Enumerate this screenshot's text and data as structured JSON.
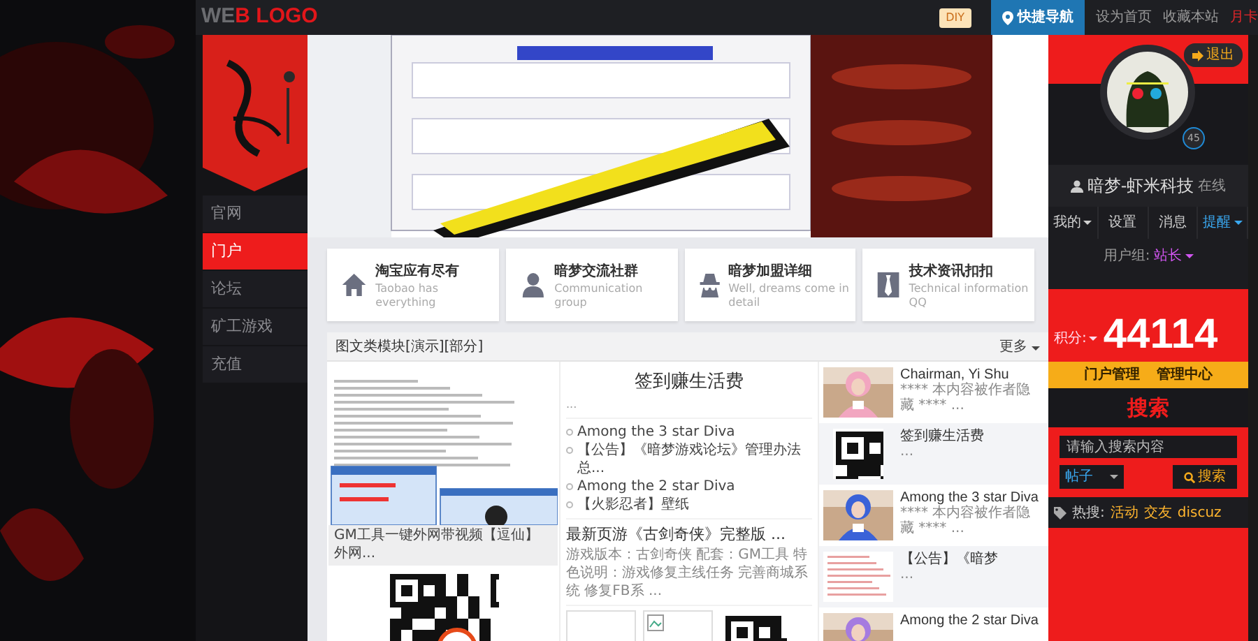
{
  "top_bar": {
    "logo": {
      "muted": "WE",
      "accent": "B LOGO"
    },
    "diy_badge": "DIY",
    "quick_nav": "快捷导航",
    "links": [
      {
        "label": "设为首页",
        "highlight": false
      },
      {
        "label": "收藏本站",
        "highlight": false
      },
      {
        "label": "月卡",
        "highlight": true
      }
    ]
  },
  "left_nav": [
    {
      "label": "官网",
      "selected": false
    },
    {
      "label": "门户",
      "selected": true
    },
    {
      "label": "论坛",
      "selected": false
    },
    {
      "label": "矿工游戏",
      "selected": false
    },
    {
      "label": "充值",
      "selected": false
    }
  ],
  "feature_cards": [
    {
      "title": "淘宝应有尽有",
      "subtitle": "Taobao has everything"
    },
    {
      "title": "暗梦交流社群",
      "subtitle": "Communication group"
    },
    {
      "title": "暗梦加盟详细",
      "subtitle": "Well, dreams come in detail"
    },
    {
      "title": "技术资讯扣扣",
      "subtitle": "Technical information QQ"
    }
  ],
  "panel": {
    "title": "图文类模块[演示][部分]",
    "more": "更多",
    "column_1": {
      "caption": "GM工具一键外网带视频【逗仙】外网..."
    },
    "column_2": {
      "title": "签到赚生活费",
      "excerpt": "...",
      "links": [
        "Among the 3 star Diva",
        "【公告】《暗梦游戏论坛》管理办法总...",
        "Among the 2 star Diva",
        "【火影忍者】壁纸"
      ],
      "article": {
        "title": "最新页游《古剑奇侠》完整版 ...",
        "summary": "游戏版本：古剑奇侠 配套：GM工具 特色说明：游戏修复主线任务 完善商城系统 修复FB系 ..."
      }
    },
    "column_3": [
      {
        "title": "Chairman, Yi Shu",
        "excerpt": "**** 本内容被作者隐藏 **** ..."
      },
      {
        "kind": "qr",
        "title": "签到赚生活费",
        "excerpt": "..."
      },
      {
        "title": "Among the 3 star Diva",
        "excerpt": "**** 本内容被作者隐藏 **** ..."
      },
      {
        "kind": "document",
        "title": "【公告】《暗梦",
        "excerpt": "..."
      },
      {
        "title": "Among the 2 star Diva"
      }
    ]
  },
  "sidebar": {
    "logout": "退出",
    "level_badge": "45",
    "username": "暗梦-虾米科技",
    "online": "在线",
    "menu": [
      {
        "label": "我的",
        "dropdown": true,
        "highlight": false
      },
      {
        "label": "设置",
        "dropdown": false,
        "highlight": false
      },
      {
        "label": "消息",
        "dropdown": false,
        "highlight": false
      },
      {
        "label": "提醒",
        "dropdown": true,
        "highlight": true
      }
    ],
    "group_label": "用户组:",
    "group": "站长",
    "credit_label": "积分:",
    "credits": "44114",
    "admin_links": [
      "门户管理",
      "管理中心"
    ],
    "search": {
      "heading": "搜索",
      "placeholder": "请输入搜索内容",
      "scope": "帖子",
      "button": "搜索"
    },
    "hot": {
      "label": "热搜:",
      "tags": [
        "活动",
        "交友",
        "discuz"
      ]
    }
  }
}
